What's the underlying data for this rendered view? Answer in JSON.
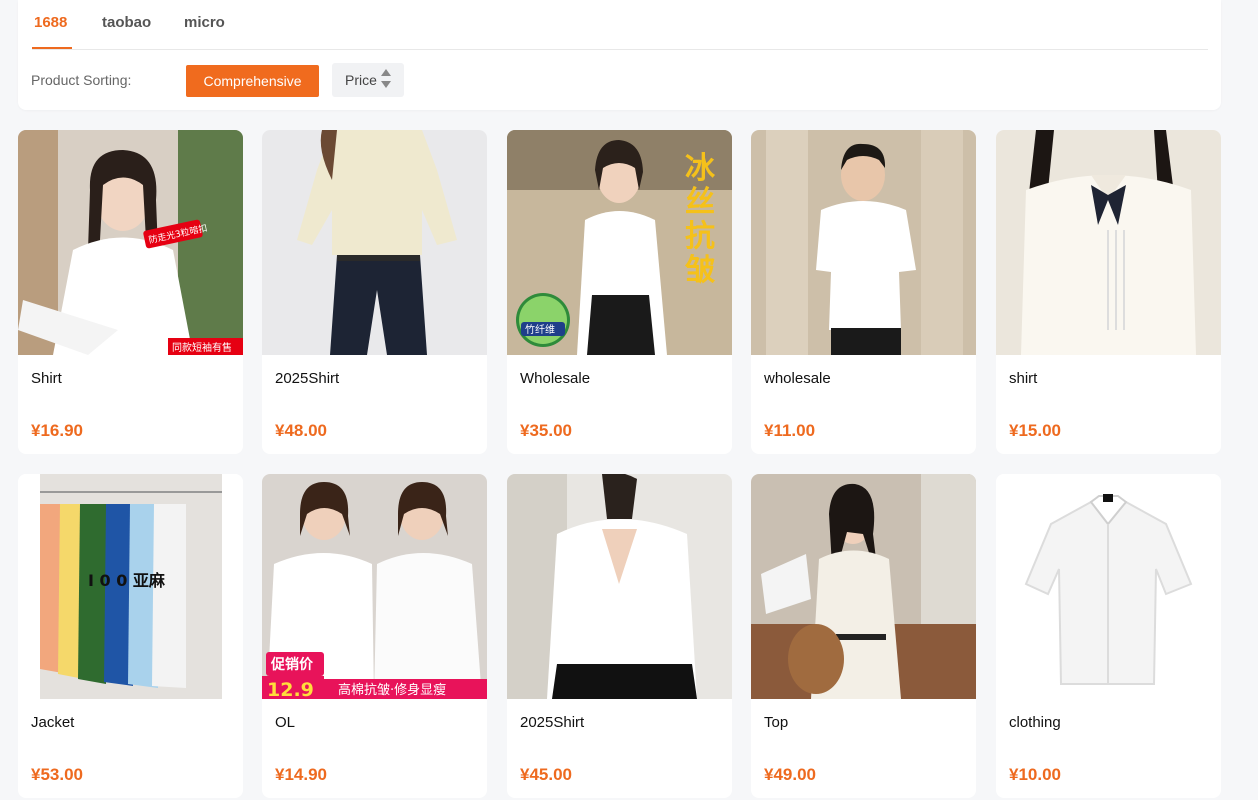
{
  "tabs": [
    {
      "label": "1688"
    },
    {
      "label": "taobao"
    },
    {
      "label": "micro"
    }
  ],
  "sorting": {
    "label": "Product Sorting:",
    "comprehensive": "Comprehensive",
    "price": "Price"
  },
  "products": [
    {
      "title": "Shirt",
      "price": "¥16.90",
      "badge": "同款短袖有售",
      "tag": "防走光3粒暗扣"
    },
    {
      "title": "2025Shirt",
      "price": "¥48.00"
    },
    {
      "title": "Wholesale",
      "price": "¥35.00",
      "overlay": "冰丝抗皱",
      "badge": "竹纤维"
    },
    {
      "title": "wholesale",
      "price": "¥11.00"
    },
    {
      "title": "shirt",
      "price": "¥15.00"
    },
    {
      "title": "Jacket",
      "price": "¥53.00",
      "overlay": "I 0 0 亚麻"
    },
    {
      "title": "OL",
      "price": "¥14.90",
      "badge": "促销价",
      "promo": "12.9",
      "banner": "高棉抗皱·修身显瘦"
    },
    {
      "title": "2025Shirt",
      "price": "¥45.00"
    },
    {
      "title": "Top",
      "price": "¥49.00"
    },
    {
      "title": "clothing",
      "price": "¥10.00"
    }
  ],
  "colors": {
    "accent": "#ee6a1f"
  }
}
